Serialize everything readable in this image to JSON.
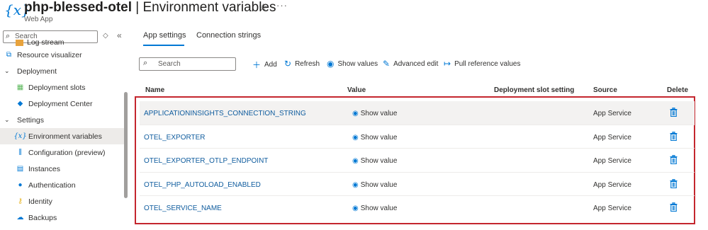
{
  "header": {
    "title_bold": "php-blessed-otel",
    "title_rest": "| Environment variables",
    "subtitle": "Web App",
    "star_icon": "star-icon",
    "more_label": "···"
  },
  "sidebar": {
    "search_placeholder": "Search",
    "items": [
      {
        "label": "Log stream",
        "icon": "log-stream-icon",
        "level": "child"
      },
      {
        "label": "Resource visualizer",
        "icon": "resource-visualizer-icon",
        "level": "top-icon"
      },
      {
        "label": "Deployment",
        "icon": "chevron-down-icon",
        "level": "section"
      },
      {
        "label": "Deployment slots",
        "icon": "deployment-slots-icon",
        "level": "child"
      },
      {
        "label": "Deployment Center",
        "icon": "deployment-center-icon",
        "level": "child"
      },
      {
        "label": "Settings",
        "icon": "chevron-down-icon",
        "level": "section"
      },
      {
        "label": "Environment variables",
        "icon": "environment-variables-icon",
        "level": "child",
        "selected": true
      },
      {
        "label": "Configuration (preview)",
        "icon": "configuration-icon",
        "level": "child"
      },
      {
        "label": "Instances",
        "icon": "instances-icon",
        "level": "child"
      },
      {
        "label": "Authentication",
        "icon": "authentication-icon",
        "level": "child"
      },
      {
        "label": "Identity",
        "icon": "identity-icon",
        "level": "child"
      },
      {
        "label": "Backups",
        "icon": "backups-icon",
        "level": "child"
      }
    ]
  },
  "tabs": [
    {
      "label": "App settings",
      "active": true
    },
    {
      "label": "Connection strings",
      "active": false
    }
  ],
  "toolbar": {
    "search_placeholder": "Search",
    "add_label": "Add",
    "refresh_label": "Refresh",
    "show_values_label": "Show values",
    "advanced_edit_label": "Advanced edit",
    "pull_reference_label": "Pull reference values"
  },
  "table": {
    "columns": [
      "Name",
      "Value",
      "Deployment slot setting",
      "Source",
      "Delete"
    ],
    "rows": [
      {
        "name": "APPLICATIONINSIGHTS_CONNECTION_STRING",
        "value": "Show value",
        "source": "App Service"
      },
      {
        "name": "OTEL_EXPORTER",
        "value": "Show value",
        "source": "App Service"
      },
      {
        "name": "OTEL_EXPORTER_OTLP_ENDPOINT",
        "value": "Show value",
        "source": "App Service"
      },
      {
        "name": "OTEL_PHP_AUTOLOAD_ENABLED",
        "value": "Show value",
        "source": "App Service"
      },
      {
        "name": "OTEL_SERVICE_NAME",
        "value": "Show value",
        "source": "App Service"
      }
    ]
  },
  "colors": {
    "accent": "#0078d4",
    "link": "#0f5c9e",
    "highlight_border": "#c4262e"
  }
}
